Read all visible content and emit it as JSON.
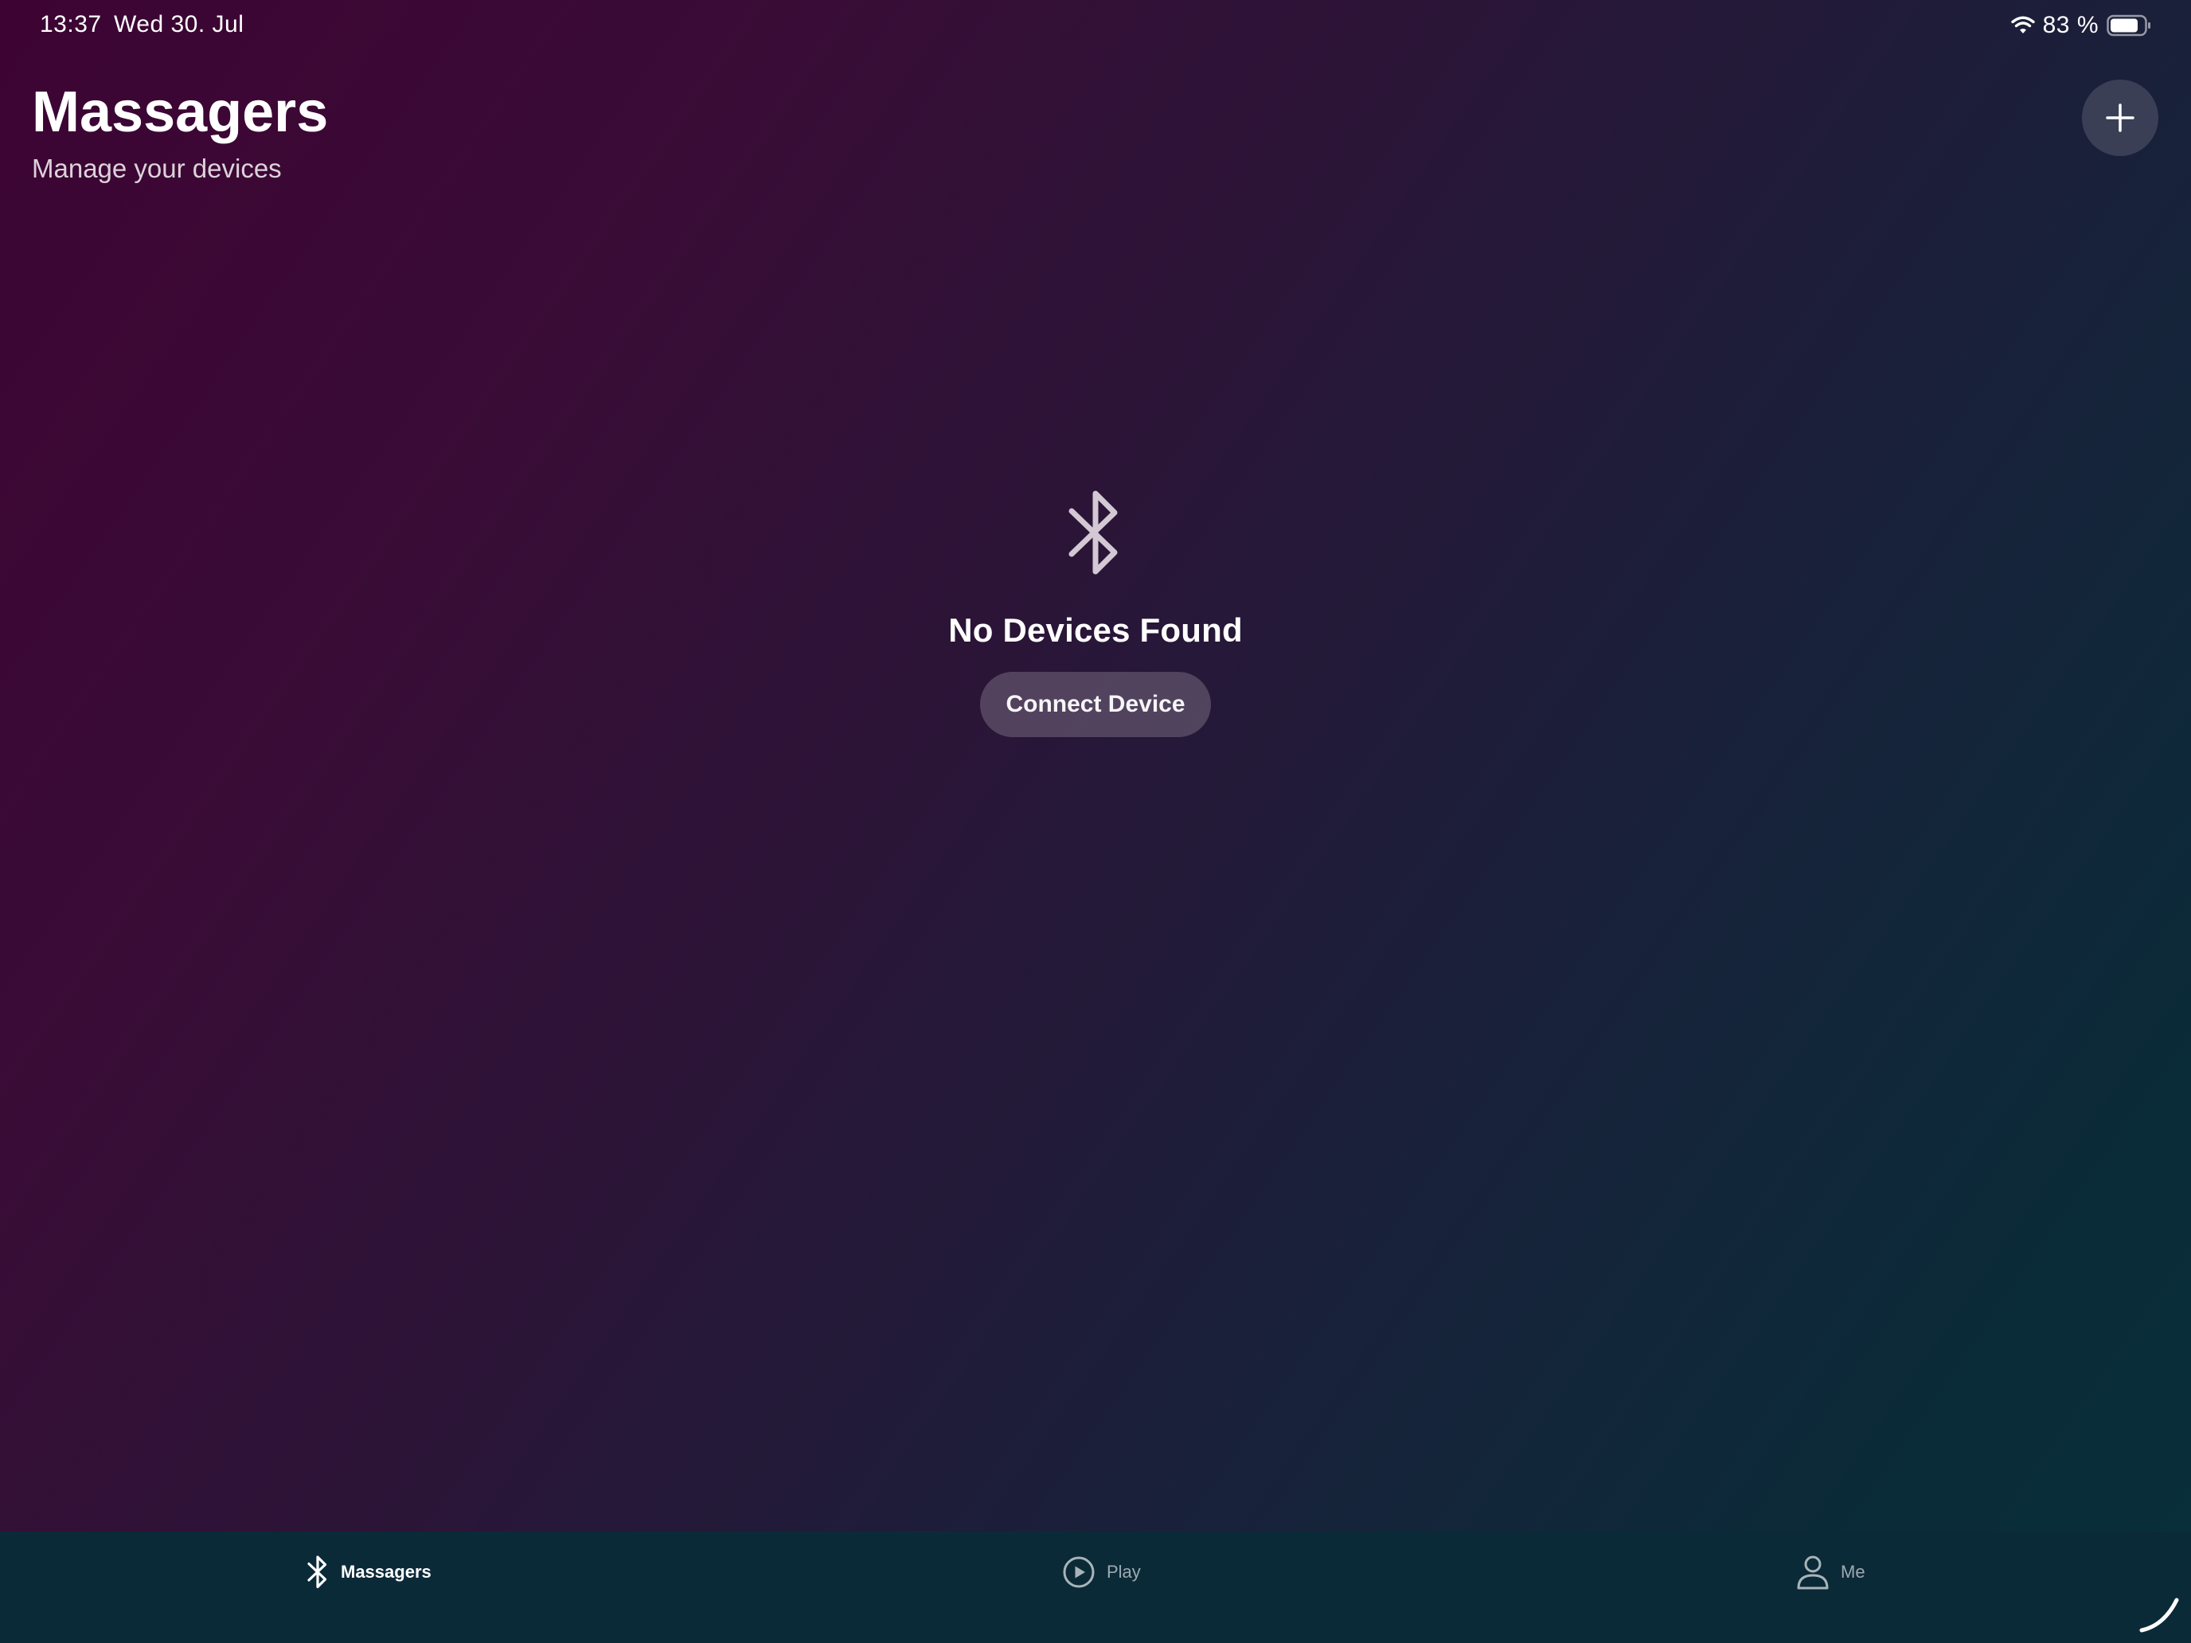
{
  "status_bar": {
    "time": "13:37",
    "date": "Wed 30. Jul",
    "battery_percent": "83 %",
    "battery_level": 0.83,
    "icons": [
      "wifi-icon",
      "battery-icon"
    ]
  },
  "header": {
    "title": "Massagers",
    "subtitle": "Manage your devices",
    "add_icon": "plus-icon"
  },
  "empty_state": {
    "icon": "bluetooth-icon",
    "title": "No Devices Found",
    "button_label": "Connect Device"
  },
  "tab_bar": {
    "tabs": [
      {
        "label": "Massagers",
        "icon": "bluetooth-icon",
        "active": true
      },
      {
        "label": "Play",
        "icon": "play-circle-icon",
        "active": false
      },
      {
        "label": "Me",
        "icon": "person-icon",
        "active": false
      }
    ]
  },
  "colors": {
    "background_start": "#3d0433",
    "background_end": "#08303a",
    "tab_bar": "#0b2a38",
    "button_fill": "#6e6078"
  }
}
